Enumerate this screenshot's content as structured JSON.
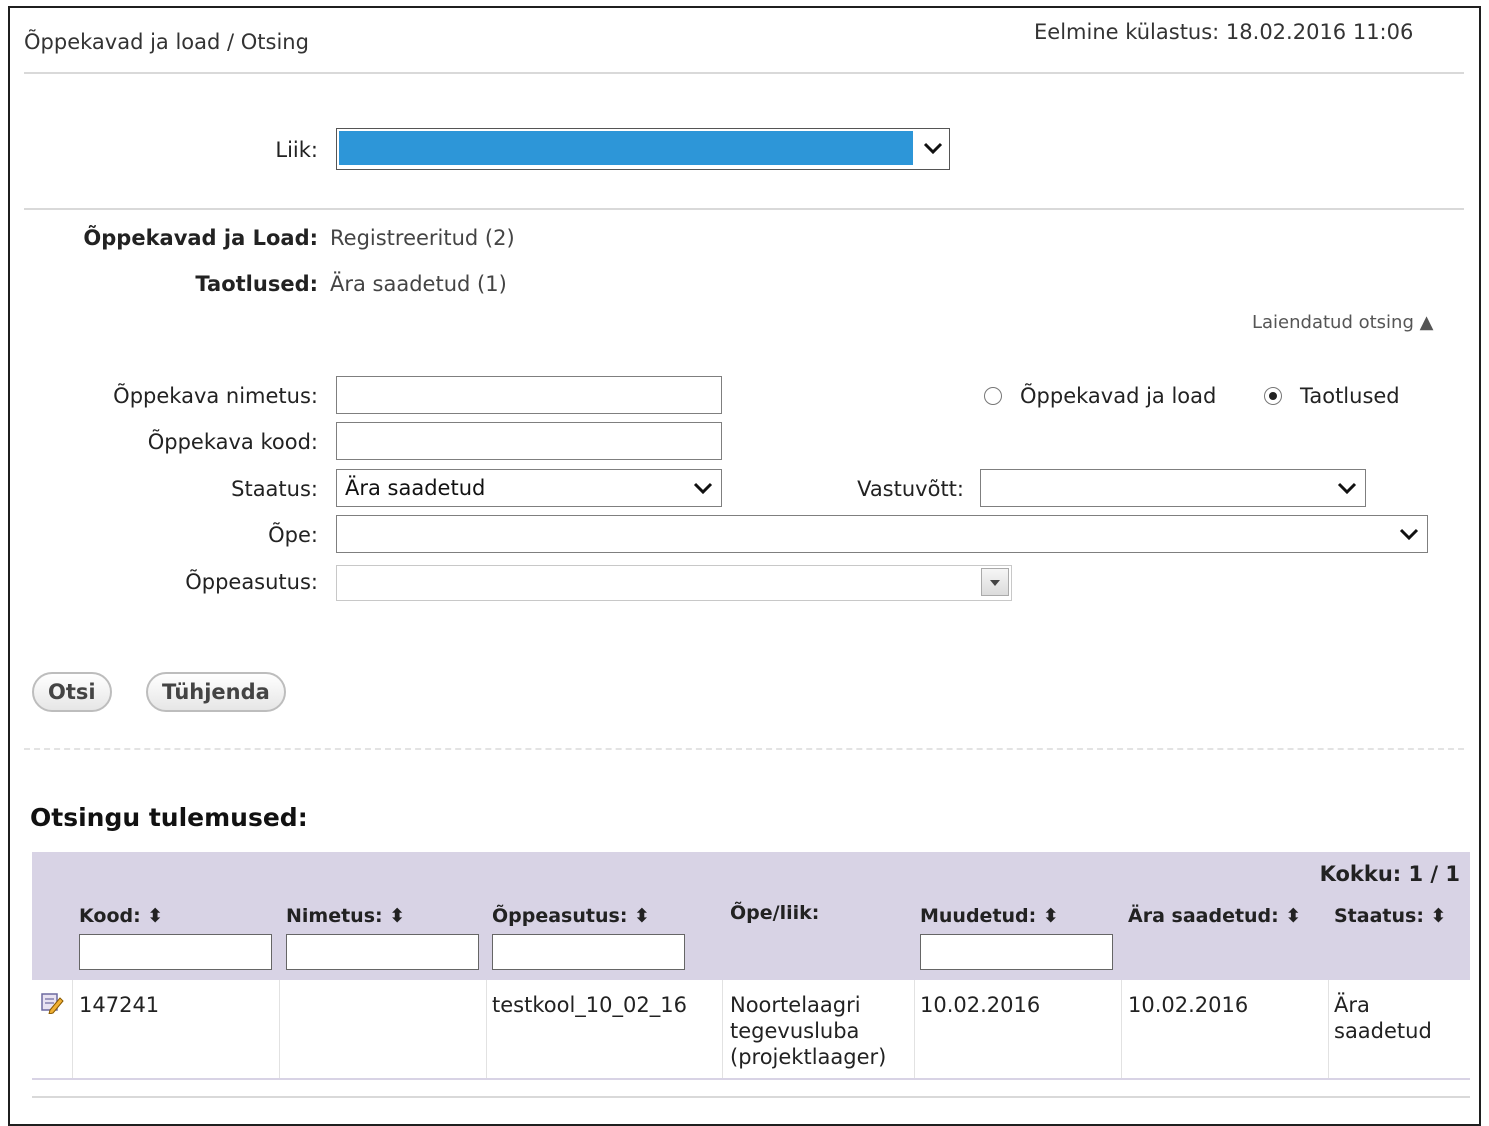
{
  "header": {
    "breadcrumb": "Õppekavad ja load  / Otsing",
    "last_visit": "Eelmine külastus: 18.02.2016 11:06"
  },
  "type_filter": {
    "label": "Liik:"
  },
  "summary": {
    "curricula_label": "Õppekavad ja Load:",
    "curricula_value": "Registreeritud (2)",
    "applications_label": "Taotlused:",
    "applications_value": "Ära saadetud (1)"
  },
  "advanced_search": {
    "label": "Laiendatud otsing ▲"
  },
  "form": {
    "name_label": "Õppekava nimetus:",
    "code_label": "Õppekava kood:",
    "status_label": "Staatus:",
    "status_value": "Ära saadetud",
    "admission_label": "Vastuvõtt:",
    "study_label": "Õpe:",
    "institution_label": "Õppeasutus:",
    "radio_curricula": "Õppekavad ja load",
    "radio_applications": "Taotlused",
    "selected_radio": "Taotlused"
  },
  "buttons": {
    "search": "Otsi",
    "clear": "Tühjenda"
  },
  "results": {
    "title": "Otsingu tulemused:",
    "total": "Kokku: 1 / 1",
    "columns": [
      "Kood: ⬍",
      "Nimetus: ⬍",
      "Õppeasutus: ⬍",
      "Õpe/liik:",
      "Muudetud: ⬍",
      "Ära saadetud: ⬍",
      "Staatus: ⬍"
    ],
    "rows": [
      {
        "kood": "147241",
        "nimetus": "",
        "oppeasutus": "testkool_10_02_16",
        "ope_liik": "Noortelaagri tegevusluba (projektlaager)",
        "muudetud": "10.02.2016",
        "ara_saadetud": "10.02.2016",
        "staatus": "Ära saadetud"
      }
    ]
  },
  "colors": {
    "accent_select": "#2d96d8",
    "table_header": "#d8d3e5"
  }
}
